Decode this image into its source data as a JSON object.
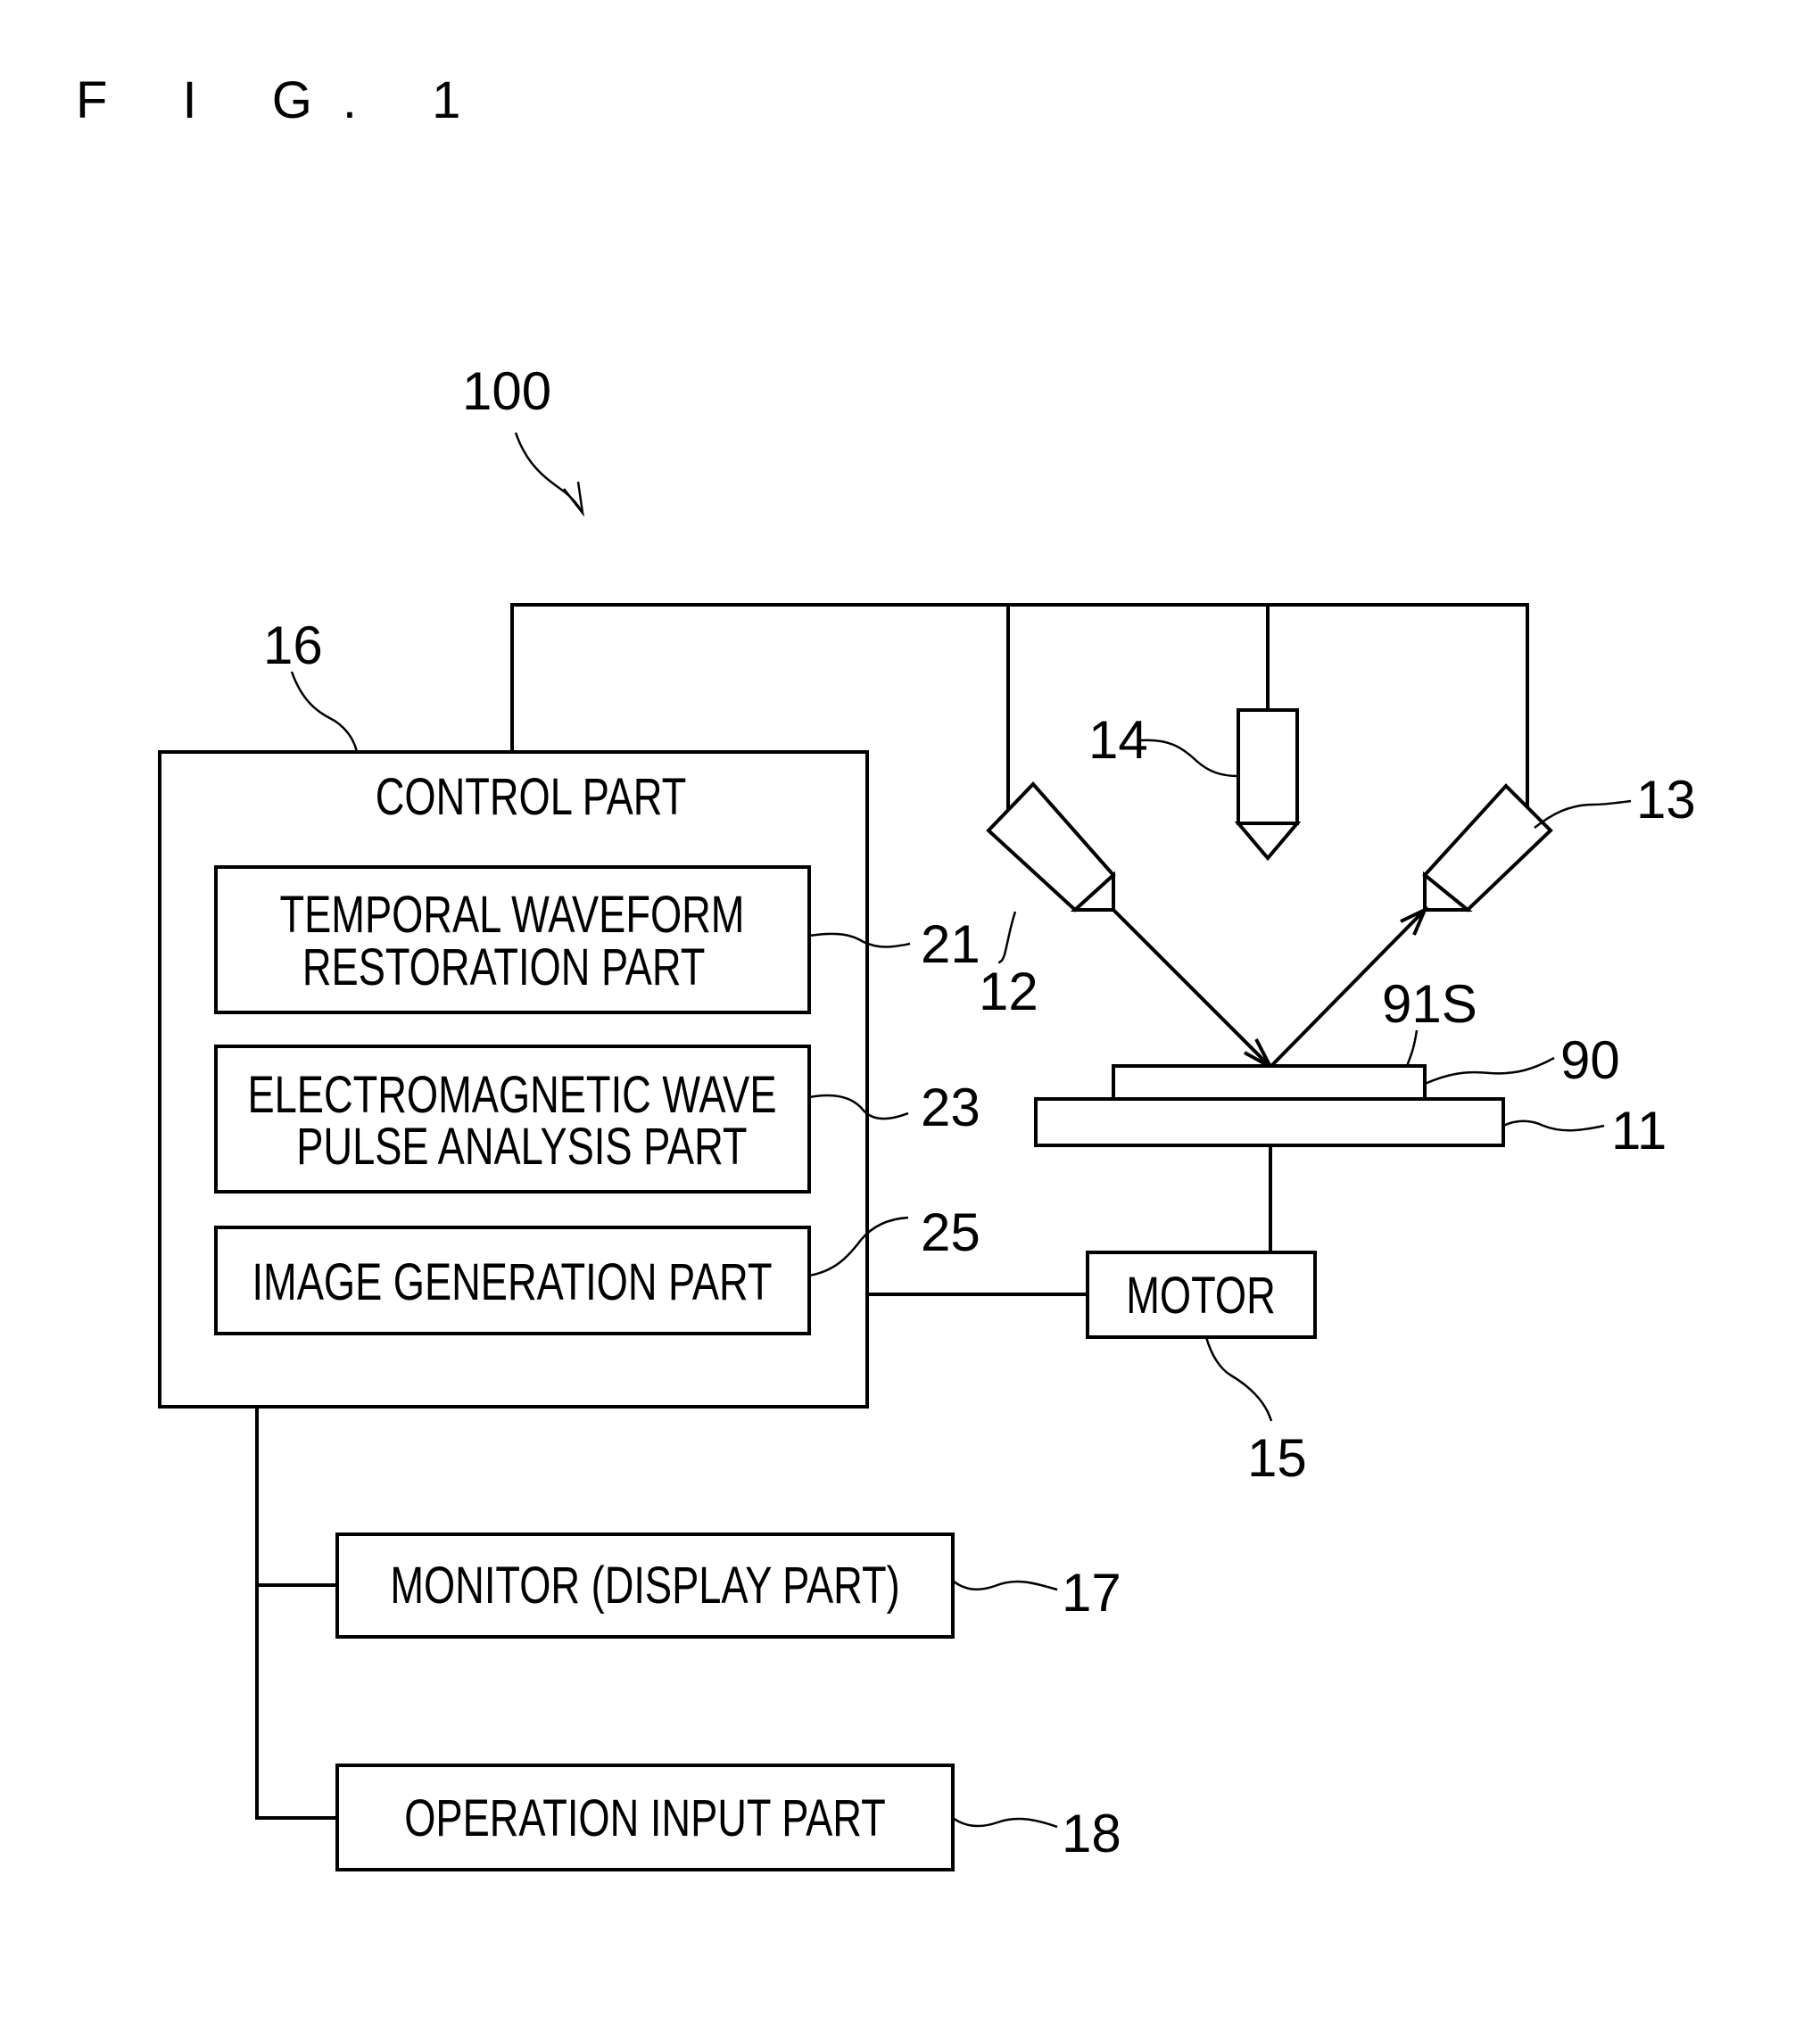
{
  "figure": {
    "title": "F I G. 1",
    "system_ref": "100"
  },
  "control_part": {
    "ref": "16",
    "label": "CONTROL PART",
    "sub_parts": [
      {
        "ref": "21",
        "lines": [
          "TEMPORAL WAVEFORM",
          "RESTORATION PART"
        ]
      },
      {
        "ref": "23",
        "lines": [
          "ELECTROMAGNETIC WAVE",
          "PULSE ANALYSIS PART"
        ]
      },
      {
        "ref": "25",
        "lines": [
          "IMAGE GENERATION PART"
        ]
      }
    ]
  },
  "optical_components": {
    "emitter": {
      "ref": "12"
    },
    "detector": {
      "ref": "13"
    },
    "camera": {
      "ref": "14"
    },
    "sample_surface": {
      "ref": "91S"
    },
    "sample": {
      "ref": "90"
    },
    "stage": {
      "ref": "11"
    }
  },
  "motor": {
    "ref": "15",
    "label": "MOTOR"
  },
  "peripherals": [
    {
      "ref": "17",
      "label": "MONITOR (DISPLAY PART)"
    },
    {
      "ref": "18",
      "label": "OPERATION INPUT PART"
    }
  ]
}
